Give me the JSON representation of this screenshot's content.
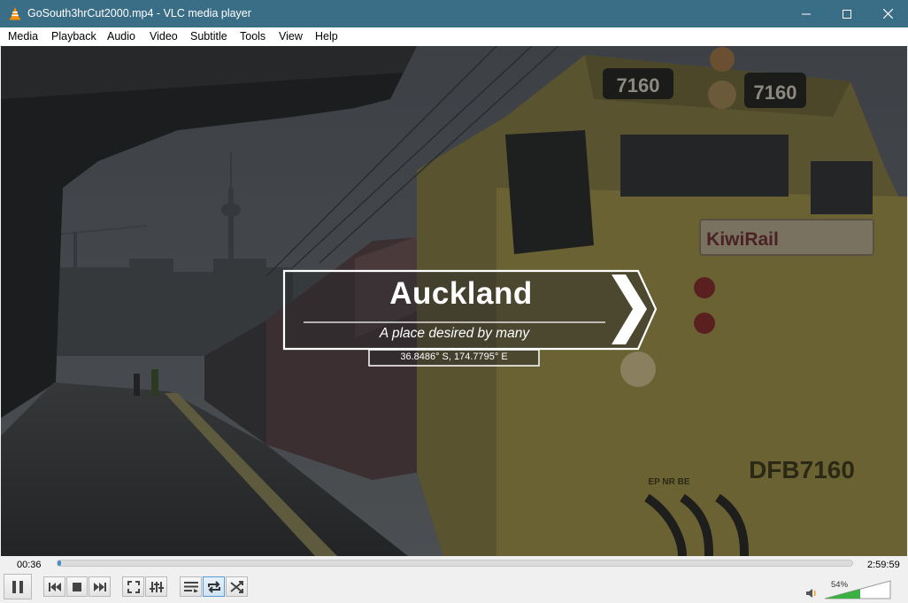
{
  "window": {
    "title": "GoSouth3hrCut2000.mp4 - VLC media player",
    "icon": "vlc-cone-icon"
  },
  "menu": [
    "Media",
    "Playback",
    "Audio",
    "Video",
    "Subtitle",
    "Tools",
    "View",
    "Help"
  ],
  "overlay": {
    "title": "Auckland",
    "subtitle": "A place desired by many",
    "coordinates": "36.8486° S, 174.7795° E"
  },
  "scene": {
    "locomotive_number": "7160",
    "cab_number_left": "7160",
    "cab_number_right": "7160",
    "logo_text": "KiwiRail",
    "side_number": "DFB7160",
    "side_small_text": "EP  NR  BE"
  },
  "playback": {
    "elapsed": "00:36",
    "total": "2:59:59",
    "progress_fraction": 0.0033
  },
  "volume": {
    "label": "54%",
    "level_fraction": 0.54
  },
  "colors": {
    "titlebar": "#3a6d86",
    "seek_fill": "#4a90c8",
    "volume_fill": "#3cb043",
    "active_button": "#5a9bd5"
  },
  "icons": {
    "pause": "pause-icon",
    "previous": "previous-icon",
    "stop": "stop-icon",
    "next": "next-icon",
    "fullscreen": "fullscreen-icon",
    "extended": "extended-settings-icon",
    "playlist": "playlist-icon",
    "loop": "loop-icon",
    "random": "random-icon",
    "volume": "speaker-icon"
  }
}
